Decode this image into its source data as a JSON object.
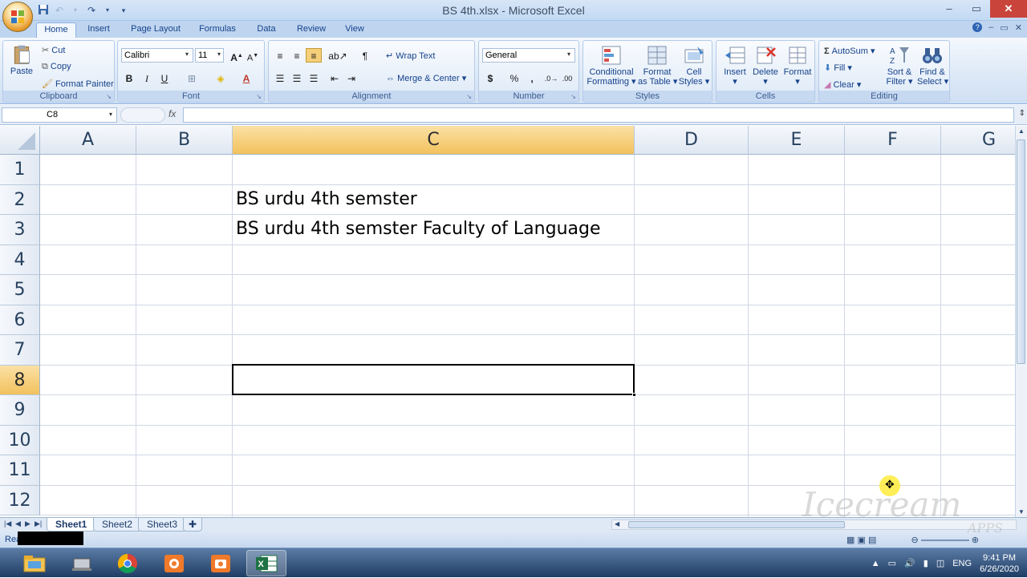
{
  "window": {
    "title": "BS 4th.xlsx - Microsoft Excel",
    "minimize": "–",
    "restore": "▭",
    "close": "✕"
  },
  "tabs": [
    "Home",
    "Insert",
    "Page Layout",
    "Formulas",
    "Data",
    "Review",
    "View"
  ],
  "ribbon_right": {
    "help": "?",
    "min": "–",
    "restore": "▭",
    "close": "✕"
  },
  "ribbon": {
    "clipboard": {
      "caption": "Clipboard",
      "paste": "Paste",
      "cut": "Cut",
      "copy": "Copy",
      "format_painter": "Format Painter"
    },
    "font": {
      "caption": "Font",
      "font_name": "Calibri",
      "font_size": "11",
      "bold": "B",
      "italic": "I",
      "underline": "U"
    },
    "alignment": {
      "caption": "Alignment",
      "wrap_text": "Wrap Text",
      "merge_center": "Merge & Center"
    },
    "number": {
      "caption": "Number",
      "format": "General",
      "currency": "$",
      "percent": "%",
      "comma": ","
    },
    "styles": {
      "caption": "Styles",
      "conditional_1": "Conditional",
      "conditional_2": "Formatting",
      "format_table_1": "Format",
      "format_table_2": "as Table",
      "cell_styles_1": "Cell",
      "cell_styles_2": "Styles"
    },
    "cells": {
      "caption": "Cells",
      "insert": "Insert",
      "delete": "Delete",
      "format": "Format"
    },
    "editing": {
      "caption": "Editing",
      "autosum": "AutoSum",
      "fill": "Fill",
      "clear": "Clear",
      "sort_1": "Sort &",
      "sort_2": "Filter",
      "find_1": "Find &",
      "find_2": "Select"
    }
  },
  "formula_bar": {
    "name_box": "C8",
    "fx": "fx",
    "value": ""
  },
  "columns": [
    "A",
    "B",
    "C",
    "D",
    "E",
    "F",
    "G"
  ],
  "selected_column": "C",
  "rows": [
    "1",
    "2",
    "3",
    "4",
    "5",
    "6",
    "7",
    "8",
    "9",
    "10",
    "11",
    "12"
  ],
  "selected_row": "8",
  "cells": {
    "C2": "BS urdu 4th semster",
    "C3": "BS urdu 4th semster Faculty of Language"
  },
  "sheets": [
    "Sheet1",
    "Sheet2",
    "Sheet3"
  ],
  "active_sheet": "Sheet1",
  "status": {
    "text": "Rea"
  },
  "taskbar": {
    "language": "ENG",
    "time": "9:41 PM",
    "date": "6/26/2020"
  },
  "watermark": {
    "text": "Icecream",
    "sub": "APPS"
  },
  "colors": {
    "ribbon_bg": "#dce8f6",
    "selected_header": "#f2c15c",
    "grid_line": "#d0d7e5",
    "excel_green": "#1f7244"
  }
}
